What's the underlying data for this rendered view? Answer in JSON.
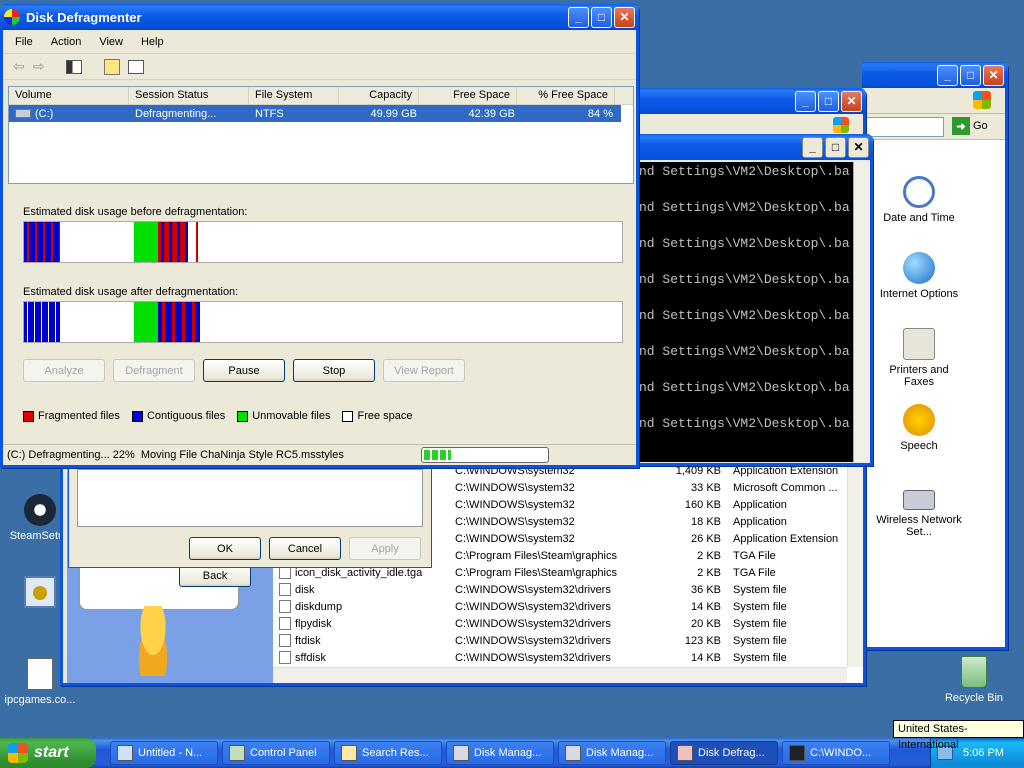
{
  "desktop": {
    "icons": [
      {
        "label": "SteamSetup",
        "icon": "steam-icon"
      },
      {
        "label": "",
        "icon": "program-icon"
      },
      {
        "label": "ipcgames.co...",
        "icon": "document-icon"
      },
      {
        "label": "Recycle Bin",
        "icon": "recycle-bin-icon"
      }
    ]
  },
  "defrag": {
    "title": "Disk Defragmenter",
    "menu": [
      "File",
      "Action",
      "View",
      "Help"
    ],
    "columns": [
      "Volume",
      "Session Status",
      "File System",
      "Capacity",
      "Free Space",
      "% Free Space"
    ],
    "volume": {
      "name": "(C:)",
      "status": "Defragmenting...",
      "fs": "NTFS",
      "capacity": "49.99 GB",
      "free": "42.39 GB",
      "pct": "84 %"
    },
    "before_label": "Estimated disk usage before defragmentation:",
    "after_label": "Estimated disk usage after defragmentation:",
    "buttons": {
      "analyze": "Analyze",
      "defragment": "Defragment",
      "pause": "Pause",
      "stop": "Stop",
      "report": "View Report"
    },
    "legend": [
      "Fragmented files",
      "Contiguous files",
      "Unmovable files",
      "Free space"
    ],
    "legend_colors": {
      "fragmented": "#e00000",
      "contiguous": "#0000e0",
      "unmovable": "#00e000",
      "free": "#ffffff"
    },
    "status_text": "(C:) Defragmenting... 22%  Moving File ChaNinja Style RC5.msstyles",
    "progress": 0.22
  },
  "console": {
    "lines": [
      "nd Settings\\VM2\\Desktop\\.ba",
      "nd Settings\\VM2\\Desktop\\.ba",
      "nd Settings\\VM2\\Desktop\\.ba",
      "nd Settings\\VM2\\Desktop\\.ba",
      "nd Settings\\VM2\\Desktop\\.ba",
      "nd Settings\\VM2\\Desktop\\.ba",
      "nd Settings\\VM2\\Desktop\\.ba",
      "nd Settings\\VM2\\Desktop\\.ba"
    ]
  },
  "control_panel": {
    "go": "Go",
    "items": [
      "Date and Time",
      "Internet Options",
      "Printers and Faxes",
      "Speech",
      "Wireless Network Set..."
    ],
    "partial_s": "s"
  },
  "dialog": {
    "ok": "OK",
    "cancel": "Cancel",
    "apply": "Apply",
    "back": "Back"
  },
  "files": [
    {
      "name": "",
      "path": "C:\\WINDOWS\\system32",
      "size": "1,409 KB",
      "type": "Application Extension"
    },
    {
      "name": "",
      "path": "C:\\WINDOWS\\system32",
      "size": "33 KB",
      "type": "Microsoft Common ..."
    },
    {
      "name": "",
      "path": "C:\\WINDOWS\\system32",
      "size": "160 KB",
      "type": "Application"
    },
    {
      "name": "",
      "path": "C:\\WINDOWS\\system32",
      "size": "18 KB",
      "type": "Application"
    },
    {
      "name": "",
      "path": "C:\\WINDOWS\\system32",
      "size": "26 KB",
      "type": "Application Extension"
    },
    {
      "name": "",
      "path": "C:\\Program Files\\Steam\\graphics",
      "size": "2 KB",
      "type": "TGA File"
    },
    {
      "name": "icon_disk_activity_idle.tga",
      "path": "C:\\Program Files\\Steam\\graphics",
      "size": "2 KB",
      "type": "TGA File"
    },
    {
      "name": "disk",
      "path": "C:\\WINDOWS\\system32\\drivers",
      "size": "36 KB",
      "type": "System file"
    },
    {
      "name": "diskdump",
      "path": "C:\\WINDOWS\\system32\\drivers",
      "size": "14 KB",
      "type": "System file"
    },
    {
      "name": "flpydisk",
      "path": "C:\\WINDOWS\\system32\\drivers",
      "size": "20 KB",
      "type": "System file"
    },
    {
      "name": "ftdisk",
      "path": "C:\\WINDOWS\\system32\\drivers",
      "size": "123 KB",
      "type": "System file"
    },
    {
      "name": "sffdisk",
      "path": "C:\\WINDOWS\\system32\\drivers",
      "size": "14 KB",
      "type": "System file"
    }
  ],
  "taskbar": {
    "start": "start",
    "tasks": [
      "Untitled - N...",
      "Control Panel",
      "Search Res...",
      "Disk Manag...",
      "Disk Manag...",
      "Disk Defrag...",
      "C:\\WINDO..."
    ],
    "tooltip": "United States-International",
    "clock": "5:06 PM"
  }
}
